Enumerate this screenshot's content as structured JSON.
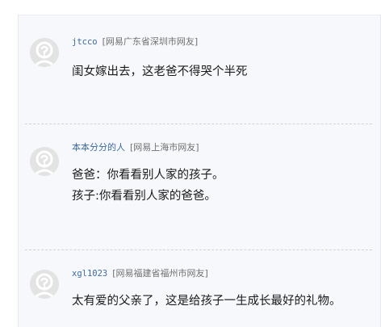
{
  "comments": [
    {
      "user": "jtcco",
      "source": "[网易广东省深圳市网友]",
      "lines": [
        "闺女嫁出去，这老爸不得哭个半死"
      ],
      "avatar_icon": "default-avatar-icon"
    },
    {
      "user": "本本分分的人",
      "source": "[网易上海市网友]",
      "lines": [
        "爸爸：你看看别人家的孩子。",
        "孩子:你看看别人家的爸爸。"
      ],
      "avatar_icon": "default-avatar-icon"
    },
    {
      "user": "xgl1023",
      "source": "[网易福建省福州市网友]",
      "lines": [
        "太有爱的父亲了，这是给孩子一生成长最好的礼物。"
      ],
      "avatar_icon": "default-avatar-icon"
    }
  ],
  "colors": {
    "username": "#3c6aa7",
    "source": "#6f6f6f",
    "text": "#1a1a1a",
    "panel_bg": "#f7f8fb",
    "avatar_bg": "#e3e3e3",
    "avatar_fg": "#ffffff"
  }
}
